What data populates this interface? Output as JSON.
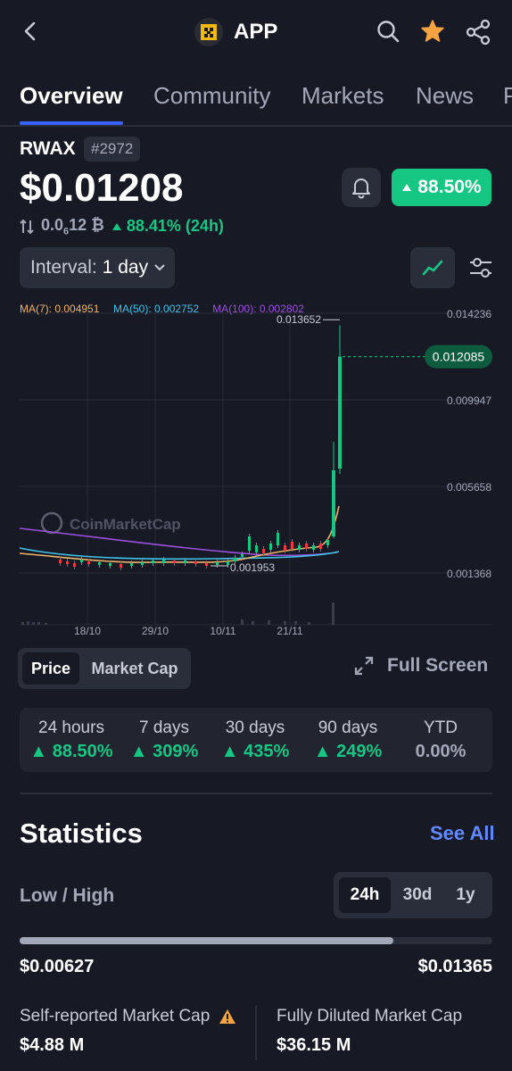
{
  "header": {
    "title": "APP"
  },
  "tabs": [
    "Overview",
    "Community",
    "Markets",
    "News",
    "P"
  ],
  "coin": {
    "symbol": "RWAX",
    "rank": "#2972",
    "price": "$0.01208",
    "change_24h": "88.50%",
    "btc_price_prefix": "0.0",
    "btc_price_sub": "6",
    "btc_price_suffix": "12 ₿",
    "btc_change": "88.41% (24h)"
  },
  "interval": {
    "label": "Interval:",
    "value": "1 day"
  },
  "chart_data": {
    "type": "line",
    "ma_legend": [
      {
        "name": "MA(7):",
        "value": "0.004951",
        "color": "#f0b46a"
      },
      {
        "name": "MA(50):",
        "value": "0.002752",
        "color": "#3fc3e8"
      },
      {
        "name": "MA(100):",
        "value": "0.002802",
        "color": "#9b51e0"
      }
    ],
    "y_ticks": [
      "0.014236",
      "0.009947",
      "0.005658",
      "0.001368"
    ],
    "y_tick_values": [
      0.014236,
      0.009947,
      0.005658,
      0.001368
    ],
    "x_ticks": [
      "18/10",
      "29/10",
      "10/11",
      "21/11"
    ],
    "high_label": "0.013652",
    "low_label": "0.001953",
    "current_label": "0.012085",
    "watermark": "CoinMarketCap",
    "colors": {
      "up": "#16c784",
      "down": "#ea3943",
      "grid": "#2a2d3a"
    }
  },
  "chart_toggle": {
    "price": "Price",
    "market_cap": "Market Cap",
    "full_screen": "Full Screen"
  },
  "performance": [
    {
      "label": "24 hours",
      "value": "88.50%",
      "up": true
    },
    {
      "label": "7 days",
      "value": "309%",
      "up": true
    },
    {
      "label": "30 days",
      "value": "435%",
      "up": true
    },
    {
      "label": "90 days",
      "value": "249%",
      "up": true
    },
    {
      "label": "YTD",
      "value": "0.00%",
      "up": false
    }
  ],
  "statistics": {
    "title": "Statistics",
    "see_all": "See All",
    "low_high_label": "Low / High",
    "ranges": [
      "24h",
      "30d",
      "1y"
    ],
    "low": "$0.00627",
    "high": "$0.01365",
    "range_position": 0.79,
    "self_reported_label": "Self-reported Market Cap",
    "self_reported_value": "$4.88 M",
    "fdmc_label": "Fully Diluted Market Cap",
    "fdmc_value": "$36.15 M"
  }
}
